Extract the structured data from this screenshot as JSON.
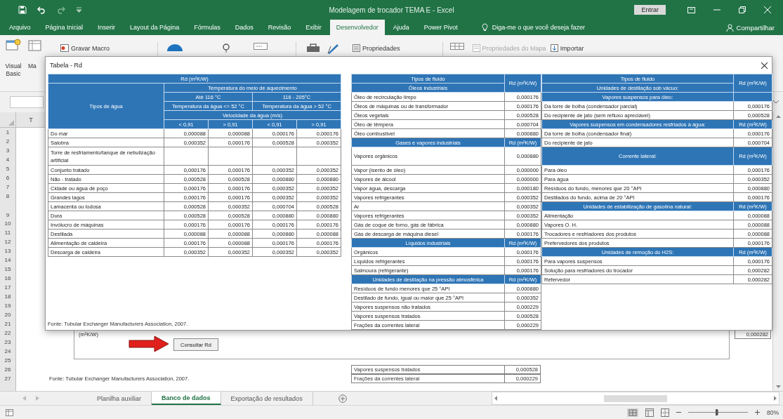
{
  "title_bar": {
    "title": "Modelagem de trocador TEMA E - Excel",
    "sign_in": "Entrar"
  },
  "ribbon_tabs": [
    {
      "label": "Arquivo",
      "selected": false
    },
    {
      "label": "Página Inicial",
      "selected": false
    },
    {
      "label": "Inserir",
      "selected": false
    },
    {
      "label": "Layout da Página",
      "selected": false
    },
    {
      "label": "Fórmulas",
      "selected": false
    },
    {
      "label": "Dados",
      "selected": false
    },
    {
      "label": "Revisão",
      "selected": false
    },
    {
      "label": "Exibir",
      "selected": false
    },
    {
      "label": "Desenvolvedor",
      "selected": true
    },
    {
      "label": "Ajuda",
      "selected": false
    },
    {
      "label": "Power Pivot",
      "selected": false
    }
  ],
  "tell_me": "Diga-me o que você deseja fazer",
  "share": "Compartilhar",
  "ribbon": {
    "large_buttons": [
      {
        "label": "Visual Basic"
      },
      {
        "label": "Ma"
      }
    ],
    "commands": [
      {
        "label": "Gravar Macro",
        "disabled": false
      },
      {
        "label": "Propriedades",
        "disabled": false
      },
      {
        "label": "Propriedades do Mapa",
        "disabled": true
      },
      {
        "label": "Importar",
        "disabled": false
      }
    ]
  },
  "column_header": "T",
  "row_numbers": [
    "1",
    "2",
    "3",
    "4",
    "5",
    "6",
    "7",
    "8",
    "9",
    "10",
    "11",
    "12",
    "13",
    "14",
    "15",
    "16",
    "17",
    "18",
    "19",
    "20",
    "21",
    "22",
    "23",
    "24",
    "25",
    "26",
    "27"
  ],
  "sheet_objects": {
    "unit_label": "(m²K/W)",
    "button": "Consultar Rd",
    "cell_value": "0,000282",
    "source": "Fonte: Tubular Exchanger Manufacturers Association, 2007.",
    "rows": [
      {
        "name": "Vapores suspensos tratados",
        "value": "0,000528"
      },
      {
        "name": "Frações da correntes lateral",
        "value": "0,000229"
      }
    ]
  },
  "dialog": {
    "title": "Tabela - Rd",
    "water_table": {
      "unit_heading": "Rd (m²K/W)",
      "row_heading": "Tipos de água",
      "medium_heading": "Temperatura do meio de aquecimento",
      "ranges": [
        "Até 116 °C",
        "116 - 205°C"
      ],
      "water_temps": [
        "Temperatura da água <= 52 °C",
        "Temperatura da água > 52 °C"
      ],
      "velocity_heading": "Velocidade da água (m/s)",
      "velocities": [
        "< 0,91",
        "> 0,91",
        "< 0,91",
        "> 0,91"
      ],
      "rows": [
        {
          "name": "Do mar",
          "values": [
            "0,000088",
            "0,000088",
            "0,000176",
            "0,000176"
          ]
        },
        {
          "name": "Salobra",
          "values": [
            "0,000352",
            "0,000176",
            "0,000528",
            "0,000352"
          ]
        },
        {
          "name": "Torre de resfriamento/tanque de nebulização artificial"
        },
        {
          "name": "Conjunto tratado",
          "values": [
            "0,000176",
            "0,000176",
            "0,000352",
            "0,000352"
          ]
        },
        {
          "name": "Não - tratado",
          "values": [
            "0,000528",
            "0,000528",
            "0,000880",
            "0,000880"
          ]
        },
        {
          "name": "Cidade ou água de poço",
          "values": [
            "0,000176",
            "0,000176",
            "0,000352",
            "0,000352"
          ]
        },
        {
          "name": "Grandes lagos",
          "values": [
            "0,000176",
            "0,000176",
            "0,000352",
            "0,000352"
          ]
        },
        {
          "name": "Lamacenta ou lodosa",
          "values": [
            "0,000528",
            "0,000352",
            "0,000704",
            "0,000528"
          ]
        },
        {
          "name": "Dura",
          "values": [
            "0,000528",
            "0,000528",
            "0,000880",
            "0,000880"
          ]
        },
        {
          "name": "Invólucro de máquinas",
          "values": [
            "0,000176",
            "0,000176",
            "0,000176",
            "0,000176"
          ]
        },
        {
          "name": "Destilada",
          "values": [
            "0,000088",
            "0,000088",
            "0,000880",
            "0,000088"
          ]
        },
        {
          "name": "Alimentação de caldeira",
          "values": [
            "0,000176",
            "0,000088",
            "0,000176",
            "0,000176"
          ]
        },
        {
          "name": "Descarga de caldeira",
          "values": [
            "0,000352",
            "0,000352",
            "0,000352",
            "0,000352"
          ]
        }
      ]
    },
    "fluid_tables": [
      {
        "heading": "Tipos de fluido",
        "group": "Óleos industriais",
        "unit": "Rd (m²K/W)",
        "rows": [
          {
            "kind": "item",
            "name": "Óleo de recirculação limpo",
            "value": "0,000176"
          },
          {
            "kind": "item",
            "name": "Óleos de máquinas ou de transformador",
            "value": "0,000176"
          },
          {
            "kind": "item",
            "name": "Óleos vegetais",
            "value": "0,000528"
          },
          {
            "kind": "item",
            "name": "Óleo de têmpera",
            "value": "0,000704"
          },
          {
            "kind": "item",
            "name": "Óleo combustível",
            "value": "0,000880"
          },
          {
            "kind": "section",
            "name": "Gases e vapores industriais",
            "unit": "Rd (m²K/W)"
          },
          {
            "kind": "tall_item",
            "name": "Vapores orgânicos",
            "value": "0,000880"
          },
          {
            "kind": "item",
            "name": "Vapor (isento de óleo)",
            "value": "0,000000"
          },
          {
            "kind": "item",
            "name": "Vapores de álcool",
            "value": "0,000000"
          },
          {
            "kind": "item",
            "name": "Vapor água, descarga",
            "value": "0,000180"
          },
          {
            "kind": "item",
            "name": "Vapores refrigerantes",
            "value": "0,000352"
          },
          {
            "kind": "item",
            "name": "Ar",
            "value": "0,000352"
          },
          {
            "kind": "item",
            "name": "Vapores refrigerantes",
            "value": "0,000352"
          },
          {
            "kind": "item",
            "name": "Gás de coque de forno, gás de fábrica",
            "value": "0,000880"
          },
          {
            "kind": "item",
            "name": "Gás de descarga de máquina diesel",
            "value": "0,000176"
          },
          {
            "kind": "section",
            "name": "Líquidos industriais",
            "unit": "Rd (m²K/W)"
          },
          {
            "kind": "item",
            "name": "Orgânicos",
            "value": "0,000176"
          },
          {
            "kind": "item",
            "name": "Líquidos refrigerantes",
            "value": "0,000176"
          },
          {
            "kind": "item",
            "name": "Salmoura (refrigerante)",
            "value": "0,000176"
          },
          {
            "kind": "section",
            "name": "Unidades de destilação na pressão atmosférica",
            "unit": "Rd (m²K/W)"
          },
          {
            "kind": "item",
            "name": "Resíduos de fundo menores que 25 °API",
            "value": "0,000880"
          },
          {
            "kind": "item",
            "name": "Destilado de fundo, igual ou maior que 25 °API",
            "value": "0,000352"
          },
          {
            "kind": "item",
            "name": "Vapores suspensos não tratados",
            "value": "0,000229"
          },
          {
            "kind": "item",
            "name": "Vapores suspensos tratados",
            "value": "0,000528"
          },
          {
            "kind": "item",
            "name": "Frações da correntes lateral",
            "value": "0,000229"
          }
        ]
      },
      {
        "heading": "Tipos de fluido",
        "group": "Unidades de destilação sob vácuo:",
        "unit": "Rd (m²K/W)",
        "rows": [
          {
            "kind": "section",
            "name": "Vapores suspensos para óleo:"
          },
          {
            "kind": "item",
            "name": "Da torre de bolha (condensador parcial)",
            "value": "0,000176"
          },
          {
            "kind": "item",
            "name": "Do recipiente de jato (sem refluxo apreciável)",
            "value": "0,000528"
          },
          {
            "kind": "section",
            "name": "Vapores suspensos em condensadores resfriados à água:",
            "unit": "Rd (m²K/W)"
          },
          {
            "kind": "item",
            "name": "Da torre de bolha (condensador final)",
            "value": "0,000176"
          },
          {
            "kind": "item",
            "name": "Do recipiente de jato",
            "value": "0,000704"
          },
          {
            "kind": "tall_section",
            "name": "Corrente lateral:",
            "unit": "Rd (m²K/W)"
          },
          {
            "kind": "item",
            "name": "Para óleo",
            "value": "0,000176"
          },
          {
            "kind": "item",
            "name": "Para água",
            "value": "0,000352"
          },
          {
            "kind": "item",
            "name": "Resíduos do fundo, menores que 20 °API",
            "value": "0,000880"
          },
          {
            "kind": "item",
            "name": "Destilados do fundo, acima de 20 °API",
            "value": "0,000176"
          },
          {
            "kind": "section",
            "name": "Unidades de estabilização de gasolina natural:",
            "unit": "Rd (m²K/W)"
          },
          {
            "kind": "item",
            "name": "Alimentação",
            "value": "0,000088"
          },
          {
            "kind": "item",
            "name": "Vapores O. H.",
            "value": "0,000088"
          },
          {
            "kind": "item",
            "name": "Trocadores e resfriadores dos produtos",
            "value": "0,000088"
          },
          {
            "kind": "item",
            "name": "Prefervedores dos produtos",
            "value": "0,000176"
          },
          {
            "kind": "section",
            "name": "Unidades de remoção do H2S:",
            "unit": "Rd (m²K/W)"
          },
          {
            "kind": "item",
            "name": "Para vapores suspensos",
            "value": "0,000176"
          },
          {
            "kind": "item",
            "name": "Solução para resfriadores do trocador",
            "value": "0,000282"
          },
          {
            "kind": "item",
            "name": "Refervedor",
            "value": "0,000282"
          }
        ]
      }
    ],
    "source": "Fonte: Tubular Exchanger Manufacturers Association, 2007."
  },
  "sheet_tabs": [
    {
      "label": "Planilha auxiliar",
      "selected": false
    },
    {
      "label": "Banco de dados",
      "selected": true
    },
    {
      "label": "Exportação de resultados",
      "selected": false
    }
  ],
  "status_bar": {
    "zoom": {
      "level": 0.47,
      "label": "80%"
    }
  }
}
